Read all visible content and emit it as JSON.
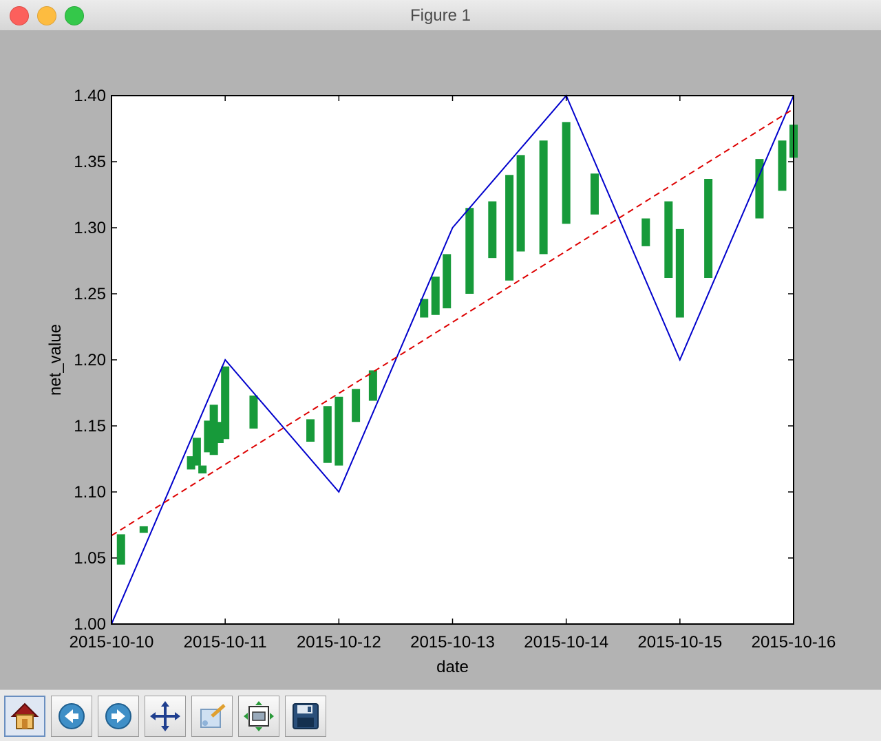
{
  "window": {
    "title": "Figure 1"
  },
  "toolbar": {
    "buttons": [
      {
        "name": "home",
        "icon": "home-icon"
      },
      {
        "name": "back",
        "icon": "back-arrow-icon"
      },
      {
        "name": "forward",
        "icon": "forward-arrow-icon"
      },
      {
        "name": "pan",
        "icon": "pan-icon"
      },
      {
        "name": "zoom",
        "icon": "zoom-rect-icon"
      },
      {
        "name": "subplots",
        "icon": "subplots-icon"
      },
      {
        "name": "save",
        "icon": "save-icon"
      }
    ]
  },
  "colors": {
    "blue_line": "#0000cc",
    "red_dashed": "#dd0000",
    "green_marks": "#179a3a"
  },
  "chart_data": {
    "type": "line",
    "xlabel": "date",
    "ylabel": "net_value",
    "x_ticks": [
      "2015-10-10",
      "2015-10-11",
      "2015-10-12",
      "2015-10-13",
      "2015-10-14",
      "2015-10-15",
      "2015-10-16"
    ],
    "y_ticks": [
      "1.00",
      "1.05",
      "1.10",
      "1.15",
      "1.20",
      "1.25",
      "1.30",
      "1.35",
      "1.40"
    ],
    "xlim": [
      "2015-10-10",
      "2015-10-16"
    ],
    "ylim": [
      1.0,
      1.4
    ],
    "grid": false,
    "series": [
      {
        "style": "solid",
        "color": "#0000cc",
        "x": [
          "2015-10-10",
          "2015-10-11",
          "2015-10-12",
          "2015-10-13",
          "2015-10-14",
          "2015-10-15",
          "2015-10-16"
        ],
        "y": [
          1.0,
          1.2,
          1.1,
          1.3,
          1.4,
          1.2,
          1.4
        ]
      },
      {
        "style": "dashed",
        "color": "#dd0000",
        "x": [
          "2015-10-10",
          "2015-10-16"
        ],
        "y": [
          1.067,
          1.39
        ]
      }
    ],
    "green_segments": [
      {
        "x": "2015-10-10 02:00",
        "y": [
          1.045,
          1.068
        ]
      },
      {
        "x": "2015-10-10 06:48",
        "y": [
          1.069,
          1.074
        ]
      },
      {
        "x": "2015-10-10 16:48",
        "y": [
          1.117,
          1.127
        ]
      },
      {
        "x": "2015-10-10 18:00",
        "y": [
          1.12,
          1.141
        ]
      },
      {
        "x": "2015-10-10 19:12",
        "y": [
          1.114,
          1.12
        ]
      },
      {
        "x": "2015-10-10 20:24",
        "y": [
          1.13,
          1.154
        ]
      },
      {
        "x": "2015-10-10 21:36",
        "y": [
          1.128,
          1.166
        ]
      },
      {
        "x": "2015-10-10 22:48",
        "y": [
          1.137,
          1.153
        ]
      },
      {
        "x": "2015-10-11 00:00",
        "y": [
          1.14,
          1.195
        ]
      },
      {
        "x": "2015-10-11 06:00",
        "y": [
          1.148,
          1.173
        ]
      },
      {
        "x": "2015-10-11 18:00",
        "y": [
          1.138,
          1.155
        ]
      },
      {
        "x": "2015-10-11 21:36",
        "y": [
          1.122,
          1.165
        ]
      },
      {
        "x": "2015-10-12 00:00",
        "y": [
          1.12,
          1.172
        ]
      },
      {
        "x": "2015-10-12 03:36",
        "y": [
          1.153,
          1.178
        ]
      },
      {
        "x": "2015-10-12 07:12",
        "y": [
          1.169,
          1.192
        ]
      },
      {
        "x": "2015-10-12 18:00",
        "y": [
          1.232,
          1.246
        ]
      },
      {
        "x": "2015-10-12 20:24",
        "y": [
          1.234,
          1.263
        ]
      },
      {
        "x": "2015-10-12 22:48",
        "y": [
          1.239,
          1.28
        ]
      },
      {
        "x": "2015-10-13 03:36",
        "y": [
          1.25,
          1.315
        ]
      },
      {
        "x": "2015-10-13 08:24",
        "y": [
          1.277,
          1.32
        ]
      },
      {
        "x": "2015-10-13 12:00",
        "y": [
          1.26,
          1.34
        ]
      },
      {
        "x": "2015-10-13 14:24",
        "y": [
          1.282,
          1.355
        ]
      },
      {
        "x": "2015-10-13 19:12",
        "y": [
          1.28,
          1.366
        ]
      },
      {
        "x": "2015-10-14 00:00",
        "y": [
          1.303,
          1.38
        ]
      },
      {
        "x": "2015-10-14 06:00",
        "y": [
          1.31,
          1.341
        ]
      },
      {
        "x": "2015-10-14 16:48",
        "y": [
          1.286,
          1.307
        ]
      },
      {
        "x": "2015-10-14 21:36",
        "y": [
          1.262,
          1.32
        ]
      },
      {
        "x": "2015-10-15 00:00",
        "y": [
          1.232,
          1.299
        ]
      },
      {
        "x": "2015-10-15 06:00",
        "y": [
          1.262,
          1.337
        ]
      },
      {
        "x": "2015-10-15 16:48",
        "y": [
          1.308,
          1.336
        ]
      },
      {
        "x": "2015-10-15 16:48",
        "y": [
          1.307,
          1.352
        ]
      },
      {
        "x": "2015-10-15 21:36",
        "y": [
          1.328,
          1.366
        ]
      },
      {
        "x": "2015-10-16 00:00",
        "y": [
          1.353,
          1.378
        ]
      }
    ]
  }
}
